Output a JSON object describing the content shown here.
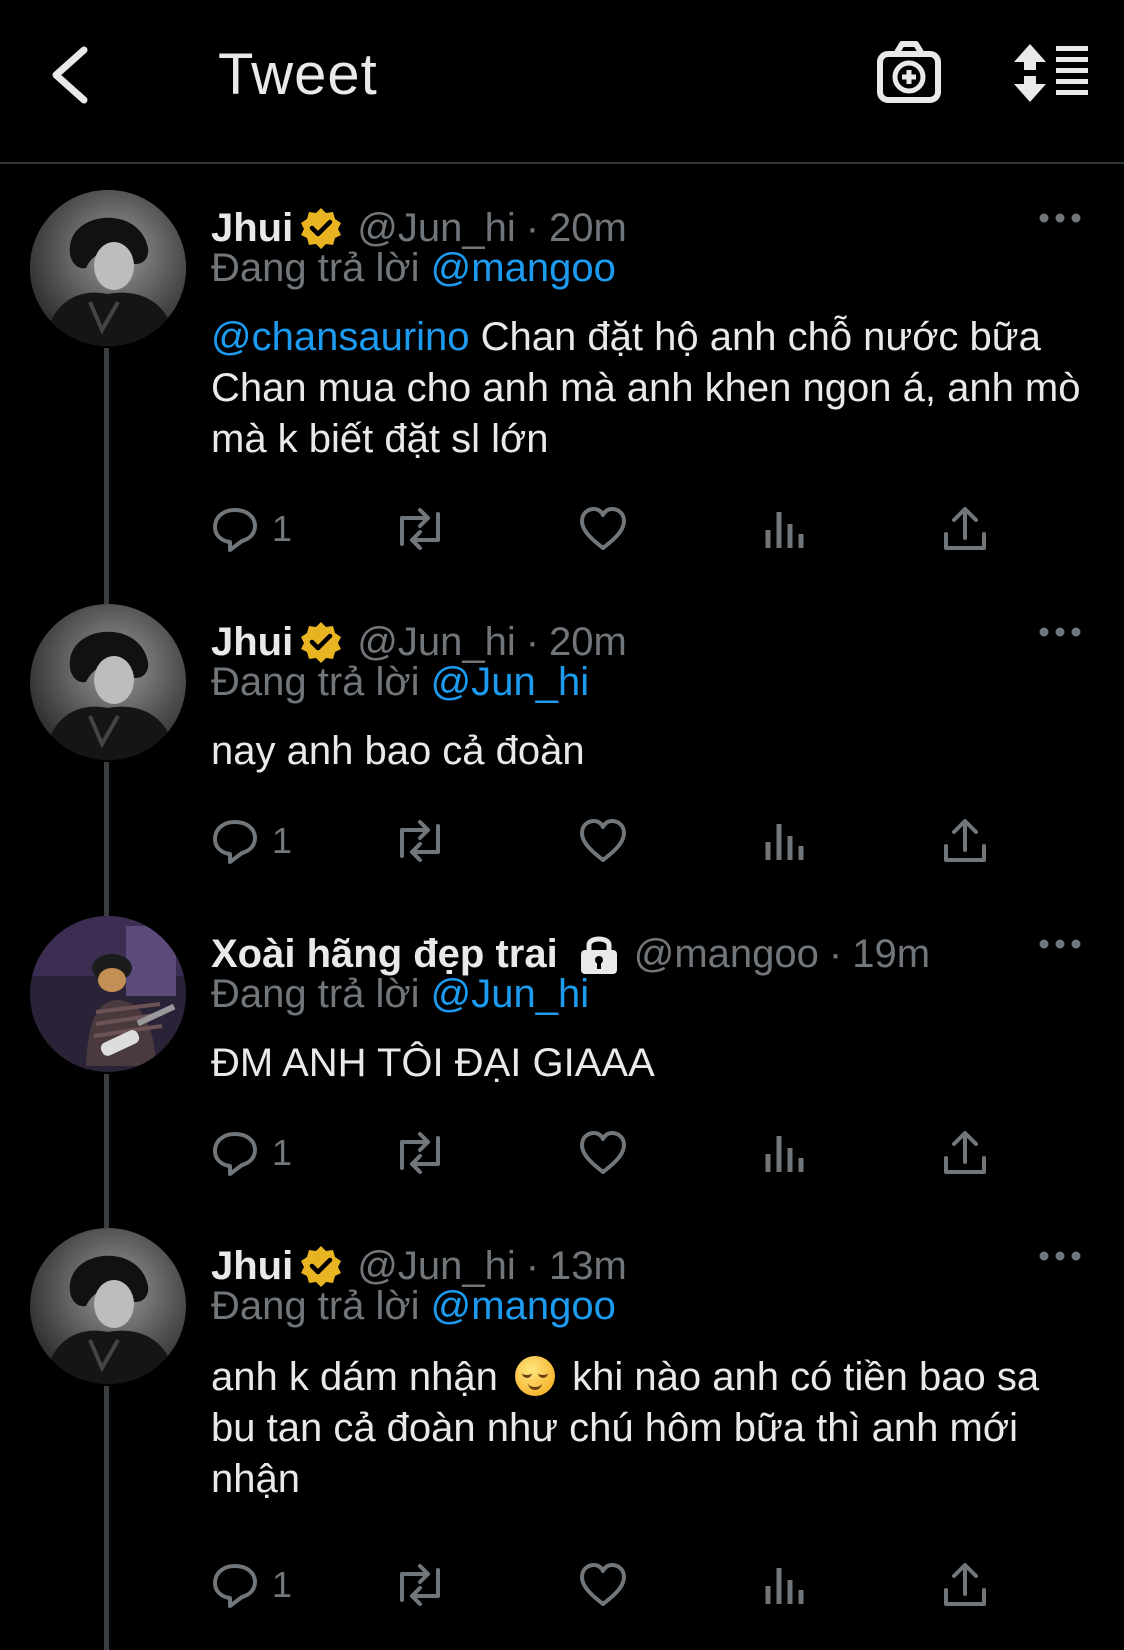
{
  "header": {
    "title": "Tweet"
  },
  "tweets": [
    {
      "name": "Jhui",
      "handle": "@Jun_hi",
      "time": "20m",
      "reply_prefix": "Đang trả lời",
      "reply_to": "@mangoo",
      "text_mention": "@chansaurino",
      "text": " Chan đặt hộ anh chỗ nước bữa Chan mua cho anh mà anh khen ngon á, anh mò mà k biết đặt sl lớn",
      "reply_count": "1"
    },
    {
      "name": "Jhui",
      "handle": "@Jun_hi",
      "time": "20m",
      "reply_prefix": "Đang trả lời",
      "reply_to": "@Jun_hi",
      "text": "nay anh bao cả đoàn",
      "reply_count": "1"
    },
    {
      "name": "Xoài hãng đẹp trai",
      "handle": "@mangoo",
      "time": "19m",
      "reply_prefix": "Đang trả lời",
      "reply_to": "@Jun_hi",
      "text": "ĐM ANH TÔI ĐẠI GIAAA",
      "reply_count": "1"
    },
    {
      "name": "Jhui",
      "handle": "@Jun_hi",
      "time": "13m",
      "reply_prefix": "Đang trả lời",
      "reply_to": "@mangoo",
      "text_part1": "anh k dám nhận ",
      "text_part2": " khi nào anh có tiền bao sa bu tan cả đoàn như chú hôm bữa thì anh mới nhận",
      "reply_count": "1"
    }
  ],
  "icons": {
    "back": "chevron-left-icon",
    "camera": "camera-plus-icon",
    "sort": "sort-arrows-list-icon",
    "verified": "verified-badge-icon",
    "lock": "lock-icon",
    "more": "more-dots-icon",
    "reply": "reply-bubble-icon",
    "retweet": "retweet-icon",
    "like": "heart-icon",
    "views": "bar-chart-icon",
    "share": "share-upload-icon",
    "emoji": "relieved-face-emoji"
  },
  "colors": {
    "background": "#000000",
    "text": "#e7e9ea",
    "muted": "#71767b",
    "link": "#1d9bf0",
    "verified": "#e8b422"
  }
}
